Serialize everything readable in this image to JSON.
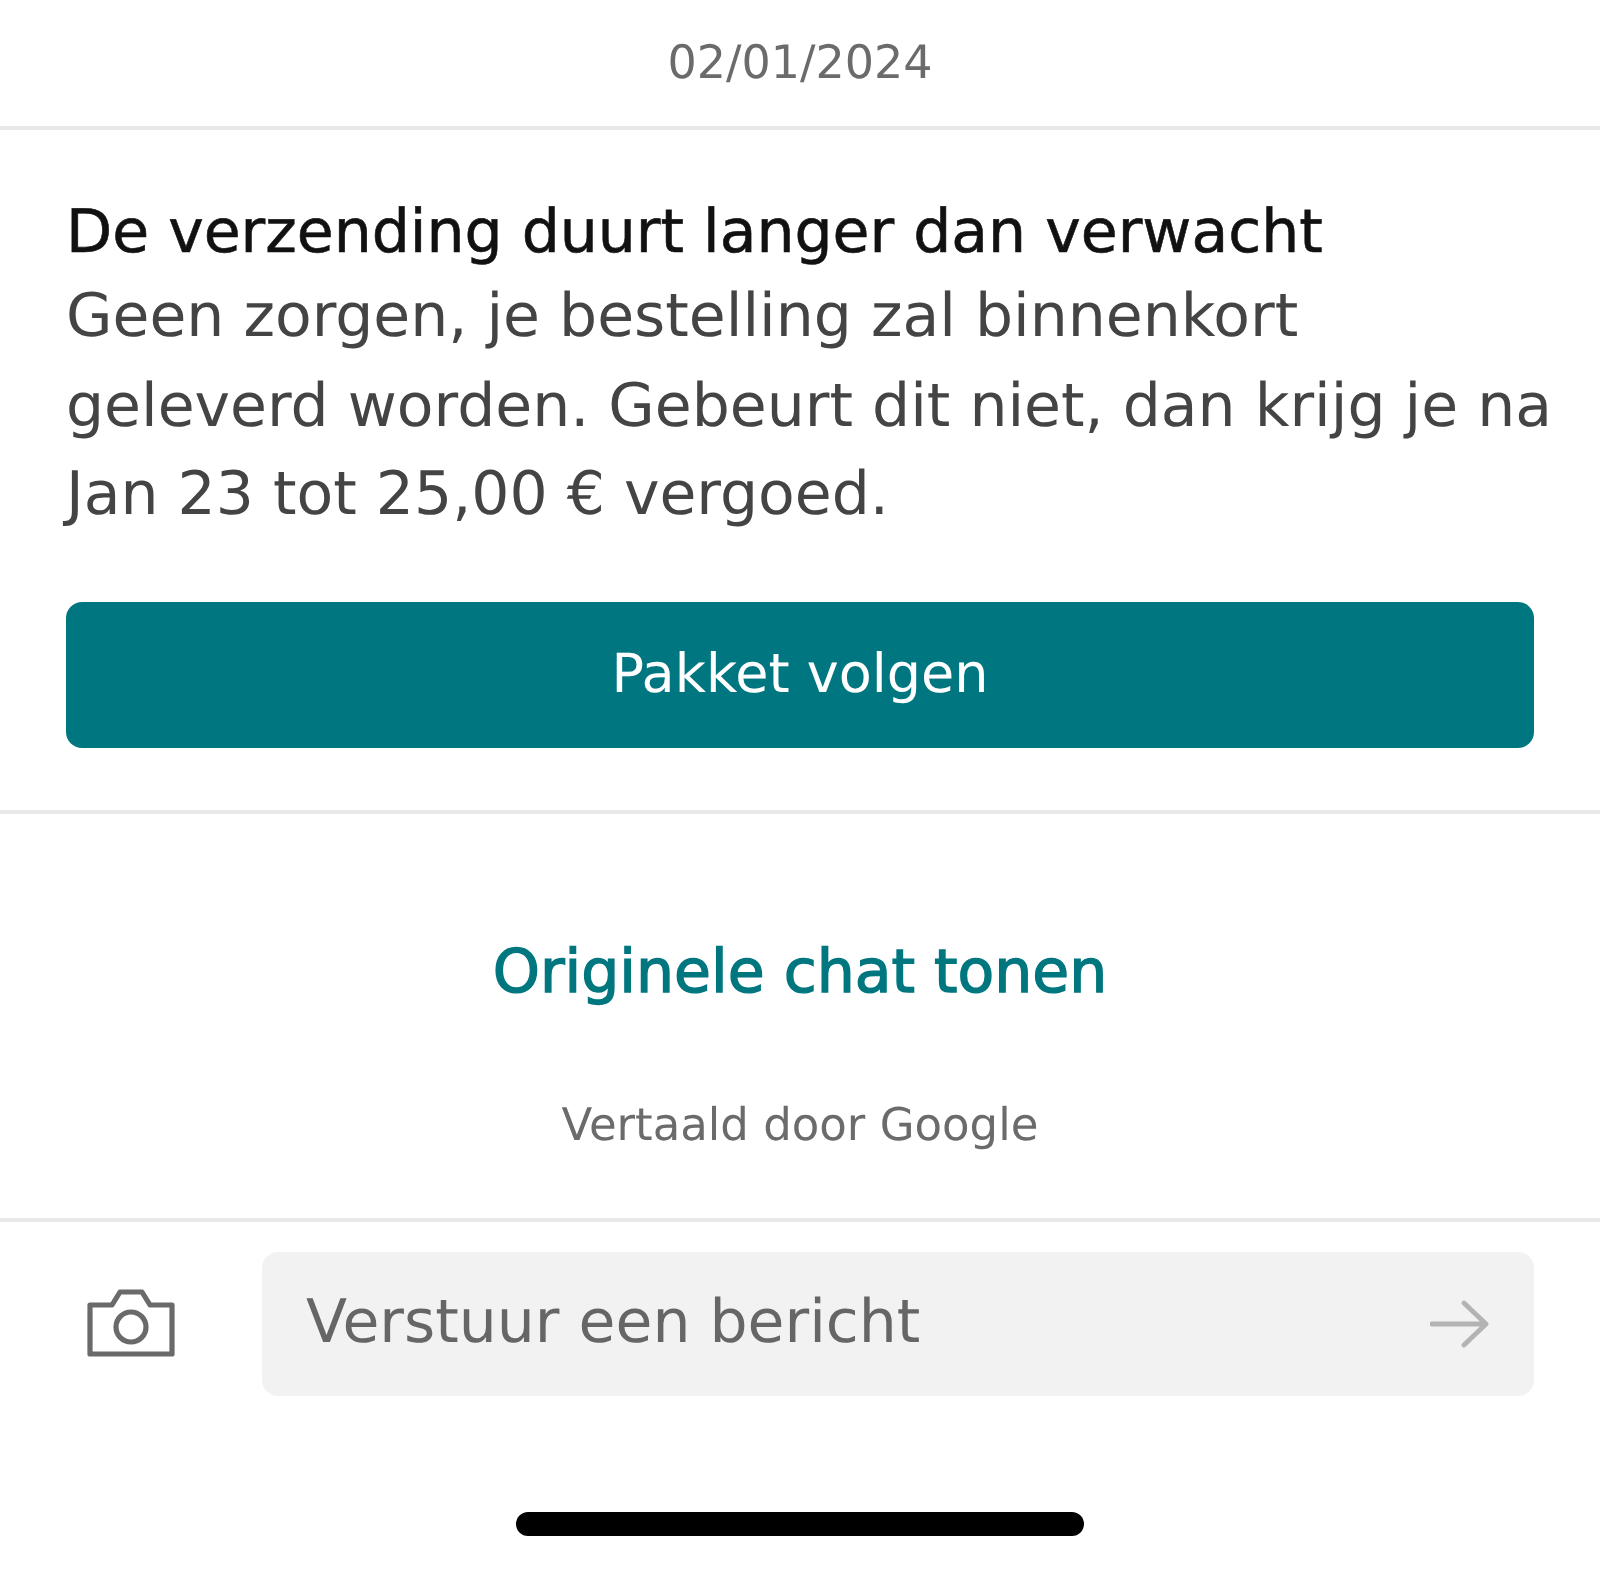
{
  "date": "02/01/2024",
  "message": {
    "title": "De verzending duurt langer dan verwacht",
    "body": "Geen zorgen, je bestelling zal binnenkort geleverd worden. Gebeurt dit niet, dan krijg je na Jan 23 tot 25,00 € vergoed.",
    "button": "Pakket volgen"
  },
  "translation": {
    "link": "Originele chat tonen",
    "note": "Vertaald door Google"
  },
  "composer": {
    "placeholder": "Verstuur een bericht"
  }
}
